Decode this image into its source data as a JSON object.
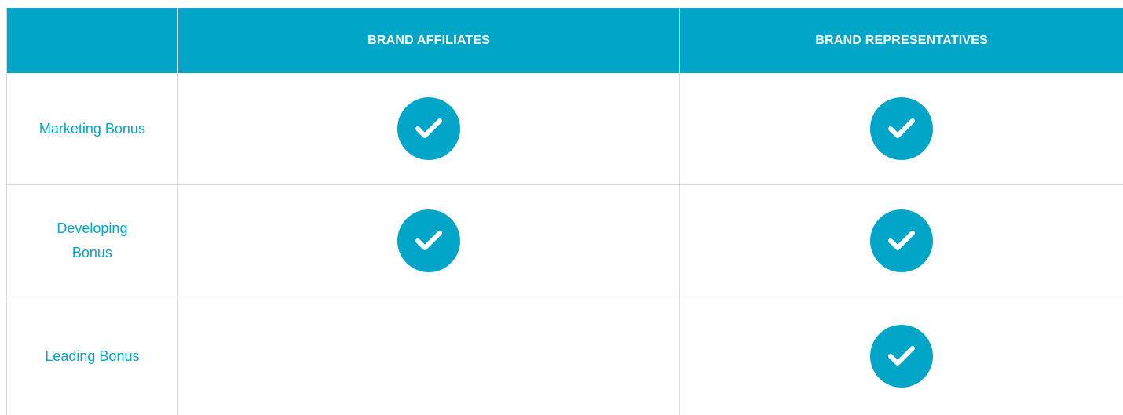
{
  "colors": {
    "accent": "#00a5c8",
    "border": "#d9d9d9",
    "header_text": "#ffffff"
  },
  "header": {
    "col_label": "",
    "col_a": "BRAND AFFILIATES",
    "col_b": "BRAND REPRESENTATIVES"
  },
  "rows": [
    {
      "label": "Marketing Bonus",
      "affiliates": true,
      "representatives": true
    },
    {
      "label": "Developing Bonus",
      "affiliates": true,
      "representatives": true
    },
    {
      "label": "Leading Bonus",
      "affiliates": false,
      "representatives": true
    }
  ],
  "icons": {
    "check": "check-circle-icon"
  }
}
